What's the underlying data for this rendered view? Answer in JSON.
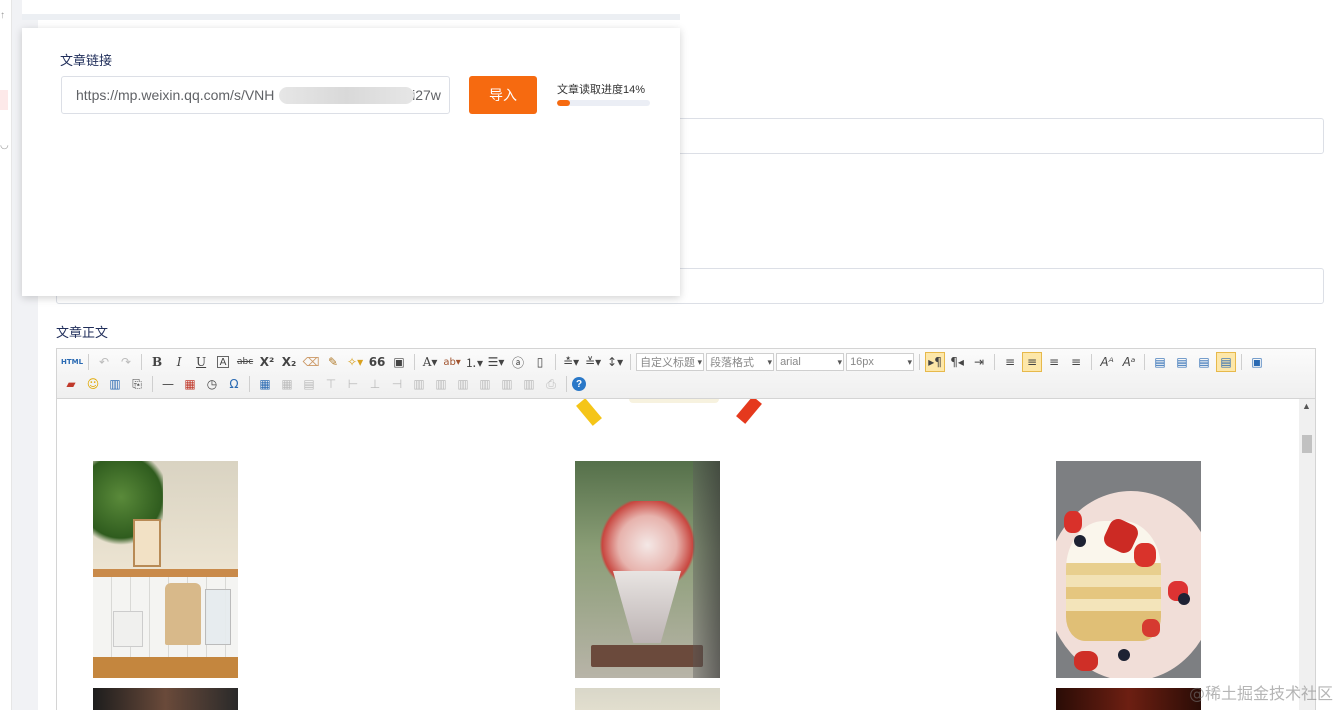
{
  "popup": {
    "link_label": "文章链接",
    "url_value": "https://mp.weixin.qq.com/s/VNH                                 Ei27w",
    "import_label": "导入",
    "progress_label": "文章读取进度14%",
    "progress_fraction": 0.14,
    "accent": "#f66a10"
  },
  "form": {
    "body_label": "文章正文"
  },
  "editor": {
    "toolbar_row1": {
      "html_label": "HTML",
      "bold": "B",
      "italic": "I",
      "underline": "U",
      "quote": "66",
      "font_color": "A",
      "custom_title": "自定义标题",
      "paragraph_format": "段落格式",
      "font_family": "arial",
      "font_size": "16px"
    },
    "toolbar_row2": {
      "omega": "Ω",
      "help": "?"
    }
  },
  "watermark": "@稀土掘金技术社区"
}
